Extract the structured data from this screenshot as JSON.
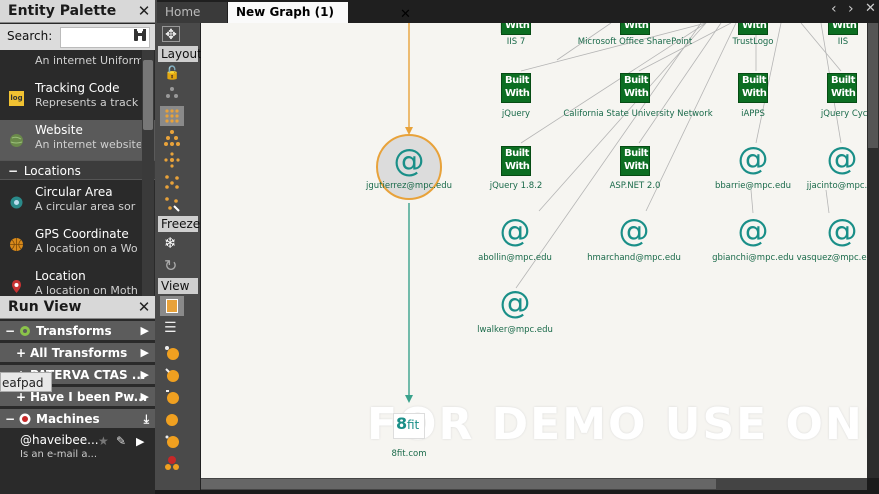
{
  "palette": {
    "title": "Entity Palette",
    "close": "✕",
    "search_label": "Search:",
    "search_value": "",
    "entities_top": [
      {
        "name": "",
        "desc": "An internet Uniform"
      },
      {
        "name": "Tracking Code",
        "desc": "Represents a track",
        "icon_text": "log"
      },
      {
        "name": "Website",
        "desc": "An internet website"
      }
    ],
    "category_locations": "Locations",
    "locations": [
      {
        "name": "Circular Area",
        "desc": "A circular area sor"
      },
      {
        "name": "GPS Coordinate",
        "desc": "A location on a Wo"
      },
      {
        "name": "Location",
        "desc": "A location on Moth"
      }
    ]
  },
  "runview": {
    "title": "Run View",
    "close": "✕",
    "rows": [
      {
        "sign": "−",
        "label": "Transforms"
      },
      {
        "sign": "+",
        "label": "All Transforms"
      },
      {
        "sign": "+",
        "label": "PATERVA CTAS ..."
      },
      {
        "sign": "+",
        "label": "Have I been Pw..."
      },
      {
        "sign": "−",
        "label": "Machines"
      }
    ],
    "tooltip": "eafpad",
    "machine_name": "@haveibee...",
    "machine_desc": "Is an e-mail a..."
  },
  "toolbar": {
    "layout_label": "Layout",
    "freeze_label": "Freeze",
    "view_label": "View"
  },
  "tabs": {
    "home": "Home",
    "graph": "New Graph (1)",
    "graph_close": "✕",
    "nav_left": "‹",
    "nav_right": "›",
    "nav_close": "✕"
  },
  "graph": {
    "watermark": "FOR DEMO USE ONLY",
    "bw_line1": "Built",
    "bw_line2": "With",
    "at_symbol": "@",
    "fit_text": "fit",
    "nodes": {
      "iis7": "IIS 7",
      "sharepoint": "Microsoft Office SharePoint",
      "trustlogo": "TrustLogo",
      "iis": "IIS",
      "jquery": "jQuery",
      "csun": "California State University Network",
      "iapps": "iAPPS",
      "jquerycycle": "jQuery Cycle",
      "jquery182": "jQuery 1.8.2",
      "aspnet": "ASP.NET 2.0",
      "bbarrie": "bbarrie@mpc.edu",
      "jjacinto": "jjacinto@mpc.edu",
      "jgutierrez": "jgutierrez@mpc.edu",
      "abollin": "abollin@mpc.edu",
      "hmarchand": "hmarchand@mpc.edu",
      "gbianchi": "gbianchi@mpc.edu",
      "vasquez": "vasquez@mpc.edu",
      "lwalker": "lwalker@mpc.edu",
      "eightfit": "8fit.com"
    }
  },
  "colors": {
    "edge_orange": "#e8a23a",
    "edge_teal": "#3aa28c",
    "edge_gray": "#b5b5b5",
    "builtwith_green": "#0c6e22",
    "email_teal": "#1a8f88"
  }
}
